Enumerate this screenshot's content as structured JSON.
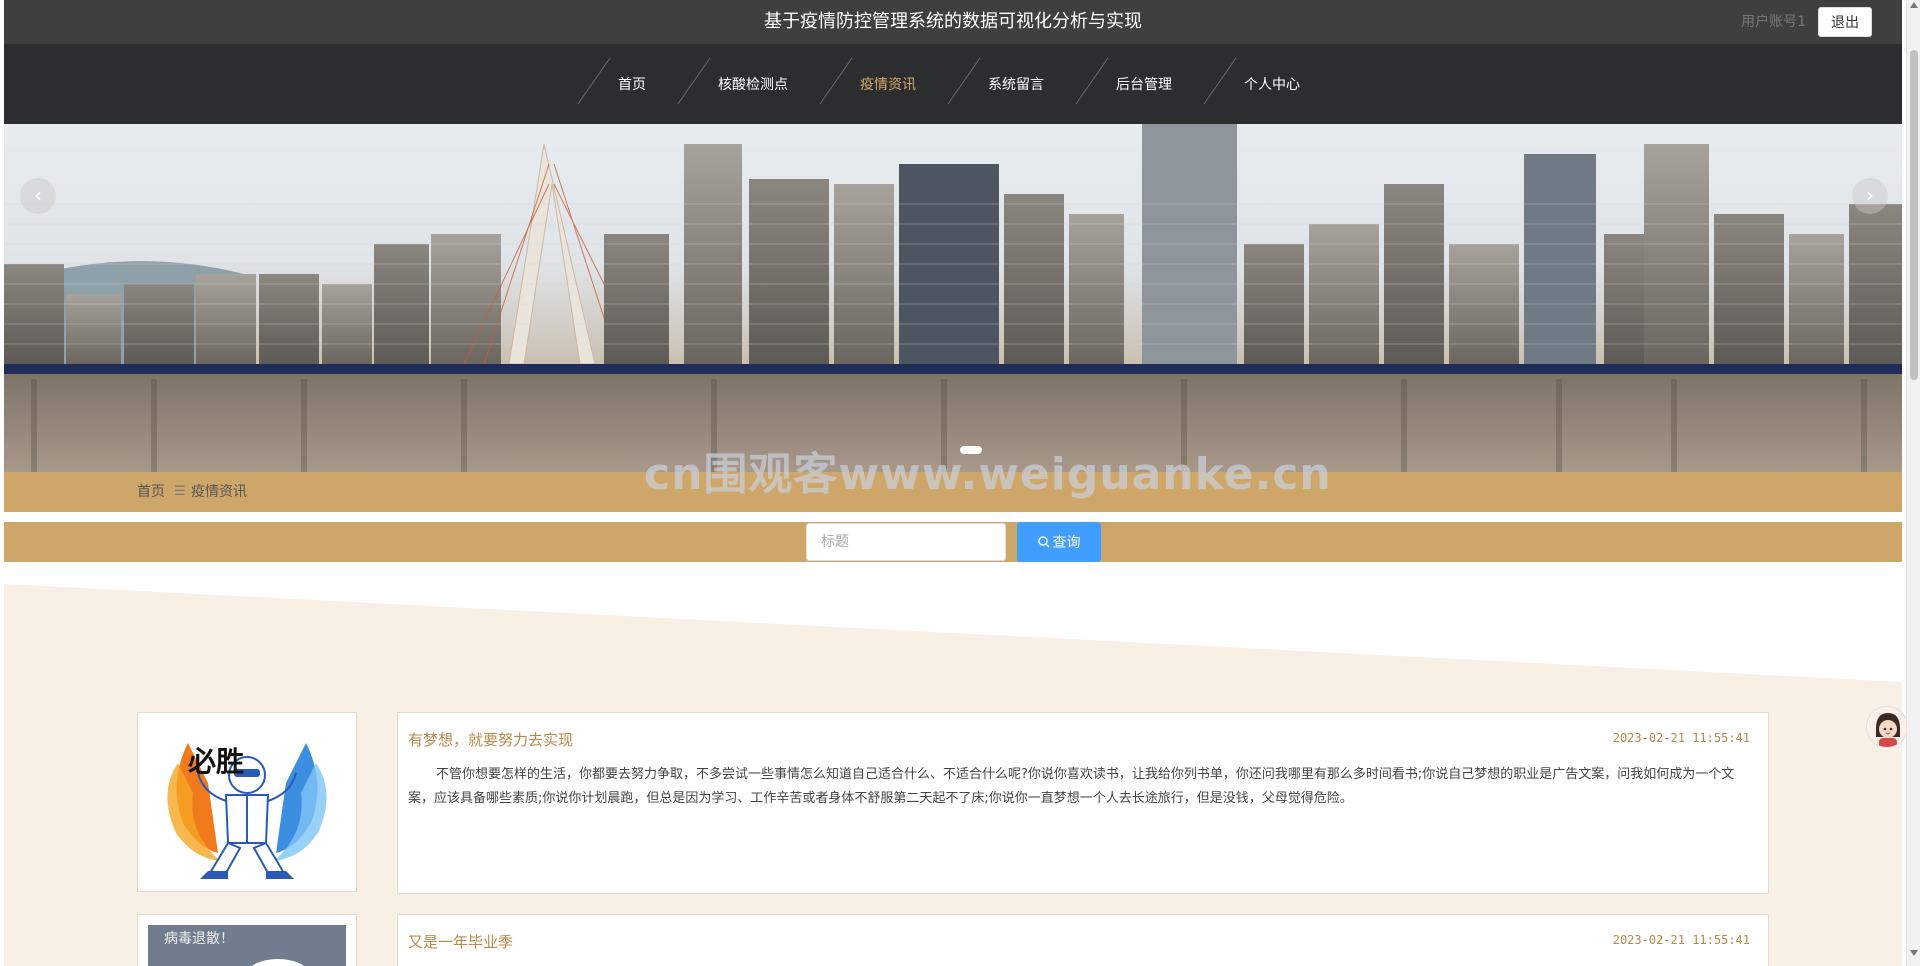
{
  "header": {
    "title": "基于疫情防控管理系统的数据可视化分析与实现",
    "user_account": "用户账号1",
    "logout_label": "退出"
  },
  "nav": {
    "items": [
      {
        "label": "首页"
      },
      {
        "label": "核酸检测点"
      },
      {
        "label": "疫情资讯"
      },
      {
        "label": "系统留言"
      },
      {
        "label": "后台管理"
      },
      {
        "label": "个人中心"
      }
    ],
    "active_index": 2
  },
  "banner": {
    "prev_label": "‹",
    "next_label": "›",
    "watermark": "cn围观客www.weiguanke.cn"
  },
  "breadcrumb": {
    "home": "首页",
    "separator": "☰",
    "current": "疫情资讯"
  },
  "search": {
    "placeholder": "标题",
    "button_label": "查询"
  },
  "articles": [
    {
      "title": "有梦想，就要努力去实现",
      "date": "2023-02-21 11:55:41",
      "summary": "不管你想要怎样的生活，你都要去努力争取，不多尝试一些事情怎么知道自己适合什么、不适合什么呢?你说你喜欢读书，让我给你列书单，你还问我哪里有那么多时间看书;你说自己梦想的职业是广告文案，问我如何成为一个文案，应该具备哪些素质;你说你计划晨跑，但总是因为学习、工作辛苦或者身体不舒服第二天起不了床;你说你一直梦想一个人去长途旅行，但是没钱，父母觉得危险。",
      "image_text": "必胜"
    },
    {
      "title": "又是一年毕业季",
      "date": "2023-02-21 11:55:41",
      "summary": "",
      "image_text": "病毒退散！"
    }
  ],
  "colors": {
    "accent": "#cfa66a",
    "nav_active": "#d4a86a",
    "button_blue": "#409eff",
    "title_gold": "#b8894b"
  }
}
